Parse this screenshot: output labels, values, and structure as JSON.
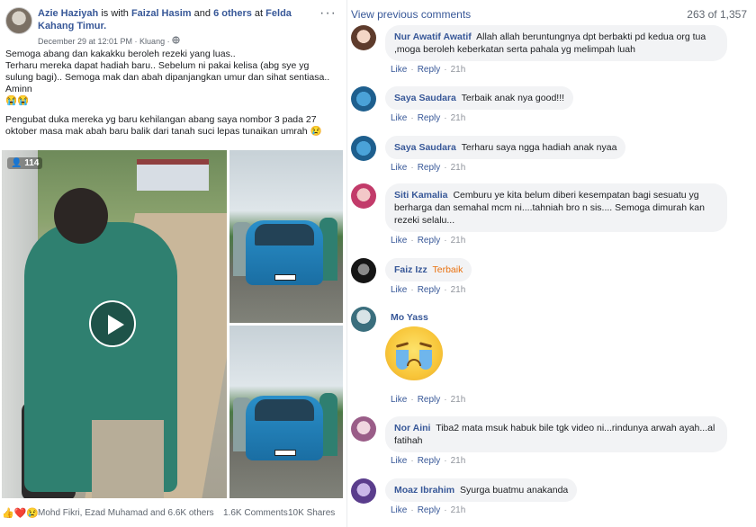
{
  "post": {
    "author": "Azie Haziyah",
    "with_text": "is with",
    "tagged": "Faizal Hasim",
    "and_text": "and",
    "others": "6 others",
    "at_text": "at",
    "place": "Felda Kahang Timur.",
    "meta": "December 29 at 12:01 PM · Kluang ·",
    "more": "···",
    "text_lines": [
      "Semoga abang dan kakakku beroleh rezeki yang luas..",
      "Terharu mereka dapat hadiah baru.. Sebelum ni pakai kelisa (abg sye yg sulung bagi).. Semoga mak dan abah dipanjangkan umur dan sihat sentiasa.. Aminn",
      "😭😭",
      "Pengubat duka mereka yg baru kehilangan abang saya nombor 3 pada 27 oktober masa mak abah baru balik dari tanah suci lepas tunaikan umrah 😢"
    ],
    "video_views": "114",
    "reaction_icons": "👍❤️😢",
    "reaction_names": "Mohd Fikri, Ezad Muhamad and 6.6K others",
    "comments_count": "1.6K Comments",
    "shares_count": "10K Shares"
  },
  "comments_panel": {
    "view_previous": "View previous comments",
    "count": "263 of 1,357",
    "like_label": "Like",
    "reply_label": "Reply",
    "items": [
      {
        "name": "Nur Awatif Awatif",
        "text": "Allah allah beruntungnya dpt berbakti pd kedua org tua ,moga beroleh keberkatan serta pahala yg melimpah luah",
        "time": "21h"
      },
      {
        "name": "Saya Saudara",
        "text": "Terbaik anak nya good!!!",
        "time": "21h"
      },
      {
        "name": "Saya Saudara",
        "text": "Terharu saya ngga hadiah anak nyaa",
        "time": "21h"
      },
      {
        "name": "Siti Kamalia",
        "text": "Cemburu ye kita belum diberi kesempatan bagi sesuatu yg berharga dan semahal mcm ni....tahniah bro n sis.... Semoga dimurah kan rezeki selalu...",
        "time": "21h"
      },
      {
        "name": "Faiz Izz",
        "text": "Terbaik",
        "time": "21h"
      },
      {
        "name": "Mo Yass",
        "text": "",
        "time": "21h"
      },
      {
        "name": "Nor Aini",
        "text": "Tiba2 mata msuk habuk bile tgk video ni...rindunya arwah ayah...al fatihah",
        "time": "21h"
      },
      {
        "name": "Moaz Ibrahim",
        "text": "Syurga buatmu anakanda",
        "time": "21h"
      }
    ]
  },
  "colors": {
    "link": "#385898",
    "bubble": "#f2f3f5",
    "meta": "#606770",
    "accent_orange": "#e9710f"
  }
}
